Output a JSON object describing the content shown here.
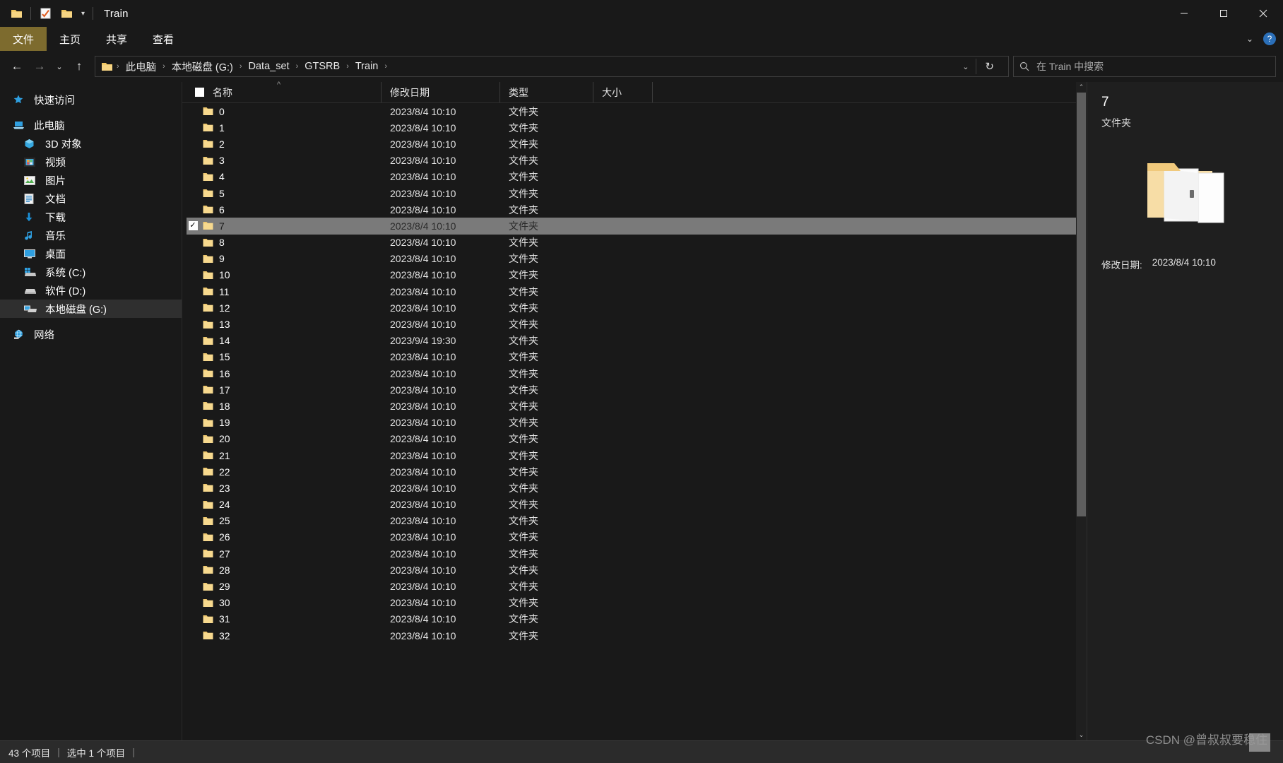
{
  "window": {
    "title": "Train",
    "quick_access_icons": [
      "folder-icon",
      "properties-icon",
      "new-folder-icon"
    ],
    "dropdown_caret": "▾",
    "minimize": "–",
    "maximize": "☐",
    "close": "✕"
  },
  "ribbon": {
    "tabs": [
      {
        "label": "文件",
        "active": true
      },
      {
        "label": "主页",
        "active": false
      },
      {
        "label": "共享",
        "active": false
      },
      {
        "label": "查看",
        "active": false
      }
    ],
    "collapse_caret": "⌄",
    "help_label": "?"
  },
  "addressbar": {
    "back": "←",
    "forward": "→",
    "recent": "⌄",
    "up": "↑",
    "breadcrumb": [
      "此电脑",
      "本地磁盘 (G:)",
      "Data_set",
      "GTSRB",
      "Train"
    ],
    "breadcrumb_separator": "›",
    "dropdown_caret": "⌄",
    "refresh": "↻",
    "search_placeholder": "在 Train 中搜索"
  },
  "sidebar": {
    "items": [
      {
        "label": "快速访问",
        "icon": "star-icon",
        "indent": false,
        "selected": false
      },
      {
        "label": "此电脑",
        "icon": "computer-icon",
        "indent": false,
        "selected": false
      },
      {
        "label": "3D 对象",
        "icon": "3d-object-icon",
        "indent": true,
        "selected": false
      },
      {
        "label": "视频",
        "icon": "video-icon",
        "indent": true,
        "selected": false
      },
      {
        "label": "图片",
        "icon": "picture-icon",
        "indent": true,
        "selected": false
      },
      {
        "label": "文档",
        "icon": "document-icon",
        "indent": true,
        "selected": false
      },
      {
        "label": "下载",
        "icon": "download-icon",
        "indent": true,
        "selected": false
      },
      {
        "label": "音乐",
        "icon": "music-icon",
        "indent": true,
        "selected": false
      },
      {
        "label": "桌面",
        "icon": "desktop-icon",
        "indent": true,
        "selected": false
      },
      {
        "label": "系统 (C:)",
        "icon": "windows-drive-icon",
        "indent": true,
        "selected": false
      },
      {
        "label": "软件 (D:)",
        "icon": "drive-icon",
        "indent": true,
        "selected": false
      },
      {
        "label": "本地磁盘 (G:)",
        "icon": "removable-drive-icon",
        "indent": true,
        "selected": true
      },
      {
        "label": "网络",
        "icon": "network-icon",
        "indent": false,
        "selected": false
      }
    ]
  },
  "filelist": {
    "columns": [
      {
        "key": "name",
        "label": "名称",
        "sorted": "asc"
      },
      {
        "key": "date",
        "label": "修改日期"
      },
      {
        "key": "type",
        "label": "类型"
      },
      {
        "key": "size",
        "label": "大小"
      }
    ],
    "sort_arrow": "^",
    "check_mark": "✓",
    "rows": [
      {
        "name": "0",
        "date": "2023/8/4 10:10",
        "type": "文件夹",
        "size": "",
        "selected": false
      },
      {
        "name": "1",
        "date": "2023/8/4 10:10",
        "type": "文件夹",
        "size": "",
        "selected": false
      },
      {
        "name": "2",
        "date": "2023/8/4 10:10",
        "type": "文件夹",
        "size": "",
        "selected": false
      },
      {
        "name": "3",
        "date": "2023/8/4 10:10",
        "type": "文件夹",
        "size": "",
        "selected": false
      },
      {
        "name": "4",
        "date": "2023/8/4 10:10",
        "type": "文件夹",
        "size": "",
        "selected": false
      },
      {
        "name": "5",
        "date": "2023/8/4 10:10",
        "type": "文件夹",
        "size": "",
        "selected": false
      },
      {
        "name": "6",
        "date": "2023/8/4 10:10",
        "type": "文件夹",
        "size": "",
        "selected": false
      },
      {
        "name": "7",
        "date": "2023/8/4 10:10",
        "type": "文件夹",
        "size": "",
        "selected": true
      },
      {
        "name": "8",
        "date": "2023/8/4 10:10",
        "type": "文件夹",
        "size": "",
        "selected": false
      },
      {
        "name": "9",
        "date": "2023/8/4 10:10",
        "type": "文件夹",
        "size": "",
        "selected": false
      },
      {
        "name": "10",
        "date": "2023/8/4 10:10",
        "type": "文件夹",
        "size": "",
        "selected": false
      },
      {
        "name": "11",
        "date": "2023/8/4 10:10",
        "type": "文件夹",
        "size": "",
        "selected": false
      },
      {
        "name": "12",
        "date": "2023/8/4 10:10",
        "type": "文件夹",
        "size": "",
        "selected": false
      },
      {
        "name": "13",
        "date": "2023/8/4 10:10",
        "type": "文件夹",
        "size": "",
        "selected": false
      },
      {
        "name": "14",
        "date": "2023/9/4 19:30",
        "type": "文件夹",
        "size": "",
        "selected": false
      },
      {
        "name": "15",
        "date": "2023/8/4 10:10",
        "type": "文件夹",
        "size": "",
        "selected": false
      },
      {
        "name": "16",
        "date": "2023/8/4 10:10",
        "type": "文件夹",
        "size": "",
        "selected": false
      },
      {
        "name": "17",
        "date": "2023/8/4 10:10",
        "type": "文件夹",
        "size": "",
        "selected": false
      },
      {
        "name": "18",
        "date": "2023/8/4 10:10",
        "type": "文件夹",
        "size": "",
        "selected": false
      },
      {
        "name": "19",
        "date": "2023/8/4 10:10",
        "type": "文件夹",
        "size": "",
        "selected": false
      },
      {
        "name": "20",
        "date": "2023/8/4 10:10",
        "type": "文件夹",
        "size": "",
        "selected": false
      },
      {
        "name": "21",
        "date": "2023/8/4 10:10",
        "type": "文件夹",
        "size": "",
        "selected": false
      },
      {
        "name": "22",
        "date": "2023/8/4 10:10",
        "type": "文件夹",
        "size": "",
        "selected": false
      },
      {
        "name": "23",
        "date": "2023/8/4 10:10",
        "type": "文件夹",
        "size": "",
        "selected": false
      },
      {
        "name": "24",
        "date": "2023/8/4 10:10",
        "type": "文件夹",
        "size": "",
        "selected": false
      },
      {
        "name": "25",
        "date": "2023/8/4 10:10",
        "type": "文件夹",
        "size": "",
        "selected": false
      },
      {
        "name": "26",
        "date": "2023/8/4 10:10",
        "type": "文件夹",
        "size": "",
        "selected": false
      },
      {
        "name": "27",
        "date": "2023/8/4 10:10",
        "type": "文件夹",
        "size": "",
        "selected": false
      },
      {
        "name": "28",
        "date": "2023/8/4 10:10",
        "type": "文件夹",
        "size": "",
        "selected": false
      },
      {
        "name": "29",
        "date": "2023/8/4 10:10",
        "type": "文件夹",
        "size": "",
        "selected": false
      },
      {
        "name": "30",
        "date": "2023/8/4 10:10",
        "type": "文件夹",
        "size": "",
        "selected": false
      },
      {
        "name": "31",
        "date": "2023/8/4 10:10",
        "type": "文件夹",
        "size": "",
        "selected": false
      },
      {
        "name": "32",
        "date": "2023/8/4 10:10",
        "type": "文件夹",
        "size": "",
        "selected": false
      }
    ],
    "scroll_up_arrow": "⌃",
    "scroll_down_arrow": "⌄"
  },
  "preview": {
    "title": "7",
    "subtitle": "文件夹",
    "icon": "open-folder-icon",
    "meta_key": "修改日期:",
    "meta_value": "2023/8/4 10:10"
  },
  "statusbar": {
    "item_count": "43 个项目",
    "separator": "|",
    "selection": "选中 1 个项目",
    "trailing_separator": "|"
  },
  "watermark": {
    "text": "CSDN @曾叔叔要稳住"
  },
  "colors": {
    "background": "#191919",
    "file_tab": "#7d6b2e",
    "selection": "#7a7a7a",
    "sidebar_selected": "#2f2f2f",
    "folder_yellow": "#f5cf7d",
    "statusbar": "#2b2b2b",
    "preview_bg": "#1f1f1f"
  }
}
